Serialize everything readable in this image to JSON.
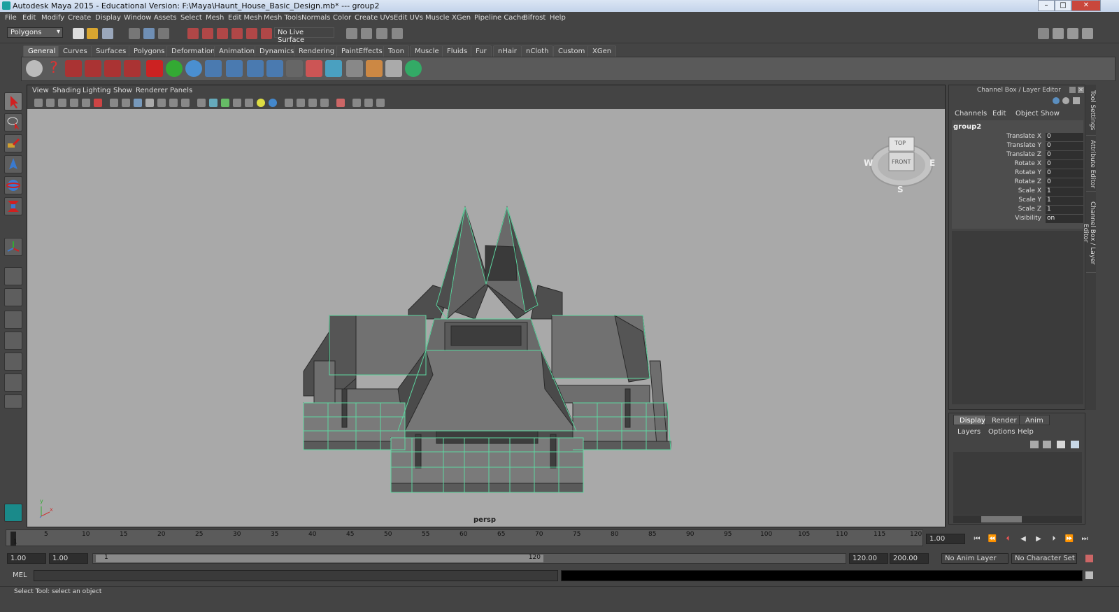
{
  "window": {
    "title": "Autodesk Maya 2015 - Educational Version: F:\\Maya\\Haunt_House_Basic_Design.mb*  ---   group2",
    "minimize": "–",
    "maximize": "□",
    "close": "✕"
  },
  "menu": [
    "File",
    "Edit",
    "Modify",
    "Create",
    "Display",
    "Window",
    "Assets",
    "Select",
    "Mesh",
    "Edit Mesh",
    "Mesh Tools",
    "Normals",
    "Color",
    "Create UVs",
    "Edit UVs",
    "Muscle",
    "XGen",
    "Pipeline Cache",
    "Bifrost",
    "Help"
  ],
  "status": {
    "menu_set": "Polygons",
    "live_surface": "No Live Surface"
  },
  "shelf_tabs": [
    "General",
    "Curves",
    "Surfaces",
    "Polygons",
    "Deformation",
    "Animation",
    "Dynamics",
    "Rendering",
    "PaintEffects",
    "Toon",
    "Muscle",
    "Fluids",
    "Fur",
    "nHair",
    "nCloth",
    "Custom",
    "XGen"
  ],
  "shelf_active": "General",
  "viewport": {
    "menu": [
      "View",
      "Shading",
      "Lighting",
      "Show",
      "Renderer",
      "Panels"
    ],
    "camera": "persp",
    "viewcube": {
      "top": "TOP",
      "front": "FRONT",
      "w": "W",
      "e": "E",
      "s": "S"
    },
    "axis": {
      "y": "y",
      "x": "x"
    }
  },
  "channel_box": {
    "title": "Channel Box / Layer Editor",
    "menu": [
      "Channels",
      "Edit",
      "Object",
      "Show"
    ],
    "object": "group2",
    "attributes": [
      {
        "name": "Translate X",
        "value": "0"
      },
      {
        "name": "Translate Y",
        "value": "0"
      },
      {
        "name": "Translate Z",
        "value": "0"
      },
      {
        "name": "Rotate X",
        "value": "0"
      },
      {
        "name": "Rotate Y",
        "value": "0"
      },
      {
        "name": "Rotate Z",
        "value": "0"
      },
      {
        "name": "Scale X",
        "value": "1"
      },
      {
        "name": "Scale Y",
        "value": "1"
      },
      {
        "name": "Scale Z",
        "value": "1"
      },
      {
        "name": "Visibility",
        "value": "on"
      }
    ]
  },
  "layer_editor": {
    "tabs": [
      "Display",
      "Render",
      "Anim"
    ],
    "active": "Display",
    "menu": [
      "Layers",
      "Options",
      "Help"
    ]
  },
  "side_tabs": [
    "Tool Settings",
    "Attribute Editor",
    "Channel Box / Layer Editor"
  ],
  "timeline": {
    "ticks": [
      "5",
      "10",
      "15",
      "20",
      "25",
      "30",
      "35",
      "40",
      "45",
      "50",
      "55",
      "60",
      "65",
      "70",
      "75",
      "80",
      "85",
      "90",
      "95",
      "100",
      "105",
      "110",
      "115",
      "120"
    ],
    "current_frame": "1",
    "current_time": "1.00"
  },
  "range": {
    "start": "1.00",
    "playback_start": "1.00",
    "slider_start": "1",
    "slider_end": "120",
    "playback_end": "120.00",
    "end": "200.00",
    "anim_layer": "No Anim Layer",
    "character_set": "No Character Set"
  },
  "command": {
    "label": "MEL"
  },
  "help_line": "Select Tool: select an object"
}
